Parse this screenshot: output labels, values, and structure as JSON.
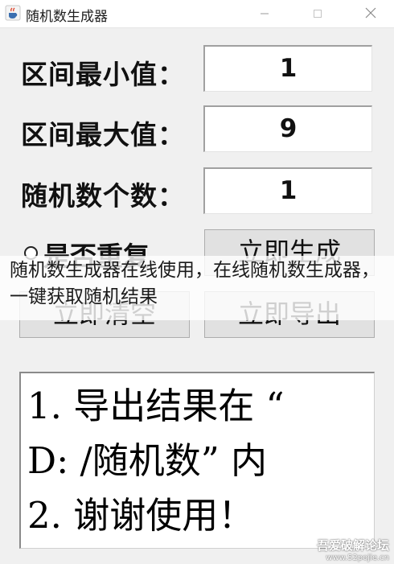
{
  "window": {
    "title": "随机数生成器",
    "icon": "java-cup-icon"
  },
  "fields": [
    {
      "label": "区间最小值：",
      "value": "1"
    },
    {
      "label": "区间最大值：",
      "value": "9"
    },
    {
      "label": "随机数个数：",
      "value": "1"
    }
  ],
  "options": {
    "repeat_label": "是否重复",
    "repeat_checked": false
  },
  "buttons": {
    "generate": "立即生成",
    "clear": "立即清空",
    "export": "立即导出"
  },
  "overlay_caption": "随机数生成器在线使用，在线随机数生成器，一键获取随机结果",
  "result": {
    "lines": [
      "1. 导出结果在 “",
      "D: /随机数” 内",
      "2. 谢谢使用！"
    ]
  },
  "watermark": {
    "title": "吾爱破解论坛",
    "url": "www.52pojie.cn"
  }
}
